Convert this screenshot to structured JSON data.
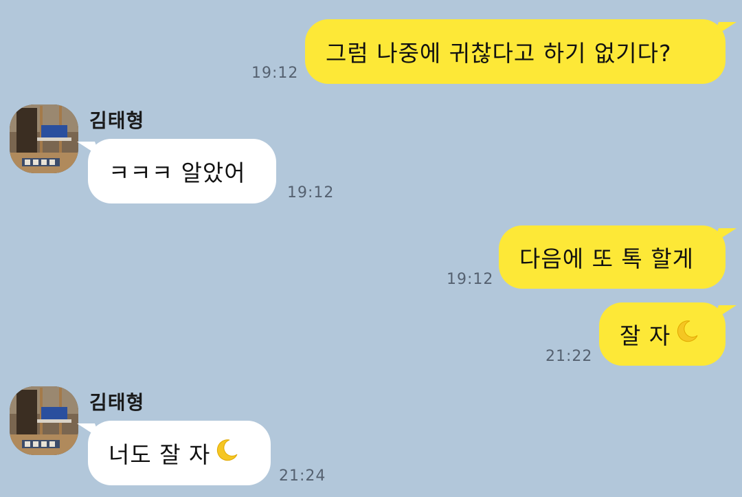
{
  "messages": [
    {
      "direction": "out",
      "text": "그럼 나중에 귀찮다고 하기 없기다?",
      "time": "19:12"
    },
    {
      "direction": "in",
      "sender": "김태형",
      "text": "ㅋㅋㅋ 알았어",
      "time": "19:12"
    },
    {
      "direction": "out",
      "text": "다음에 또 톡 할게",
      "time": "19:12"
    },
    {
      "direction": "out",
      "text": "잘 자",
      "emoji": "crescent-moon",
      "time": "21:22"
    },
    {
      "direction": "in",
      "sender": "김태형",
      "text": "너도 잘 자",
      "emoji": "crescent-moon",
      "time": "21:24"
    }
  ],
  "colors": {
    "background": "#b2c7da",
    "outgoing_bubble": "#fde837",
    "incoming_bubble": "#ffffff",
    "timestamp": "#556170"
  }
}
